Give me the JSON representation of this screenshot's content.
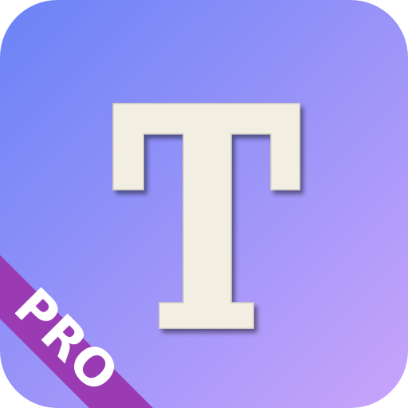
{
  "icon": {
    "glyph": "T",
    "badge": "PRO",
    "gradient_start": "#6a83f6",
    "gradient_end": "#c9a4fb",
    "glyph_color": "#f2efe2",
    "badge_color": "#9b3bb3",
    "badge_text_color": "#ffffff"
  }
}
